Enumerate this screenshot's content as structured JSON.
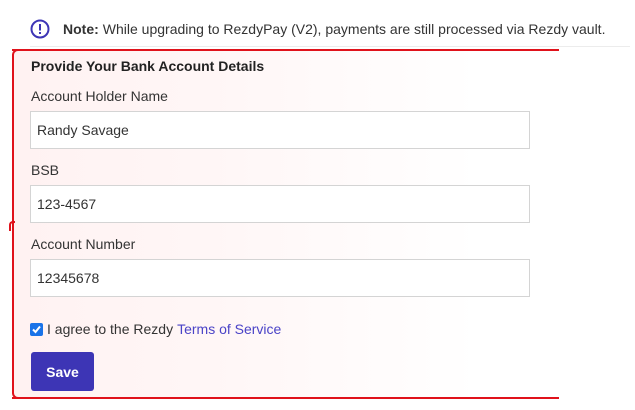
{
  "notice": {
    "icon": "info-circle-icon",
    "label": "Note:",
    "text": "While upgrading to RezdyPay (V2), payments are still processed via Rezdy vault."
  },
  "form": {
    "heading": "Provide Your Bank Account Details",
    "account_holder": {
      "label": "Account Holder Name",
      "value": "Randy Savage"
    },
    "bsb": {
      "label": "BSB",
      "value": "123-4567"
    },
    "account_number": {
      "label": "Account Number",
      "value": "12345678"
    },
    "agree": {
      "checked": true,
      "text": "I agree to the Rezdy",
      "link": "Terms of Service"
    },
    "save_label": "Save"
  },
  "colors": {
    "accent": "#3d35b5",
    "link": "#4a43c7",
    "highlight_border": "#e0121b",
    "checkbox": "#1a73e8"
  }
}
